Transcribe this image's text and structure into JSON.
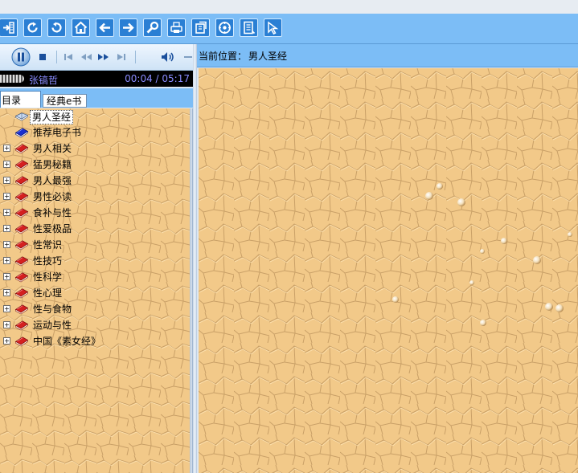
{
  "toolbar": {
    "buttons": [
      {
        "icon": "exit-icon"
      },
      {
        "icon": "refresh-icon"
      },
      {
        "icon": "undo-icon"
      },
      {
        "icon": "home-icon"
      },
      {
        "icon": "back-arrow-icon"
      },
      {
        "icon": "forward-arrow-icon"
      },
      {
        "icon": "search-icon"
      },
      {
        "icon": "print-icon"
      },
      {
        "icon": "bookmark-icon"
      },
      {
        "icon": "settings-icon"
      },
      {
        "icon": "notes-icon"
      },
      {
        "icon": "pointer-icon"
      }
    ]
  },
  "player": {
    "artist": "张镐哲",
    "time": "00:04 / 05:17"
  },
  "tabs": [
    {
      "label": "目录"
    },
    {
      "label": "经典e书"
    }
  ],
  "tree": {
    "items": [
      {
        "label": "男人圣经",
        "icon": "open-book-icon",
        "expandable": false,
        "selected": true
      },
      {
        "label": "推荐电子书",
        "icon": "blue-book-icon",
        "expandable": false,
        "selected": false
      },
      {
        "label": "男人相关",
        "icon": "red-book-icon",
        "expandable": true,
        "selected": false
      },
      {
        "label": "猛男秘籍",
        "icon": "red-book-icon",
        "expandable": true,
        "selected": false
      },
      {
        "label": "男人最强",
        "icon": "red-book-icon",
        "expandable": true,
        "selected": false
      },
      {
        "label": "男性必读",
        "icon": "red-book-icon",
        "expandable": true,
        "selected": false
      },
      {
        "label": "食补与性",
        "icon": "red-book-icon",
        "expandable": true,
        "selected": false
      },
      {
        "label": "性爱极品",
        "icon": "red-book-icon",
        "expandable": true,
        "selected": false
      },
      {
        "label": "性常识",
        "icon": "red-book-icon",
        "expandable": true,
        "selected": false
      },
      {
        "label": "性技巧",
        "icon": "red-book-icon",
        "expandable": true,
        "selected": false
      },
      {
        "label": "性科学",
        "icon": "red-book-icon",
        "expandable": true,
        "selected": false
      },
      {
        "label": "性心理",
        "icon": "red-book-icon",
        "expandable": true,
        "selected": false
      },
      {
        "label": "性与食物",
        "icon": "red-book-icon",
        "expandable": true,
        "selected": false
      },
      {
        "label": "运动与性",
        "icon": "red-book-icon",
        "expandable": true,
        "selected": false
      },
      {
        "label": "中国《素女经》",
        "icon": "red-book-icon",
        "expandable": true,
        "selected": false
      }
    ],
    "expander_symbol": "+"
  },
  "location": {
    "prefix": "当前位置：",
    "current": "男人圣经"
  },
  "colors": {
    "toolbar_bg": "#7cbdf6",
    "button_bg": "#2a7fd4",
    "pane_bg": "#f2c989",
    "artist_text": "#8a8cff",
    "book_red": "#d42020",
    "book_blue": "#1b2fd0"
  }
}
